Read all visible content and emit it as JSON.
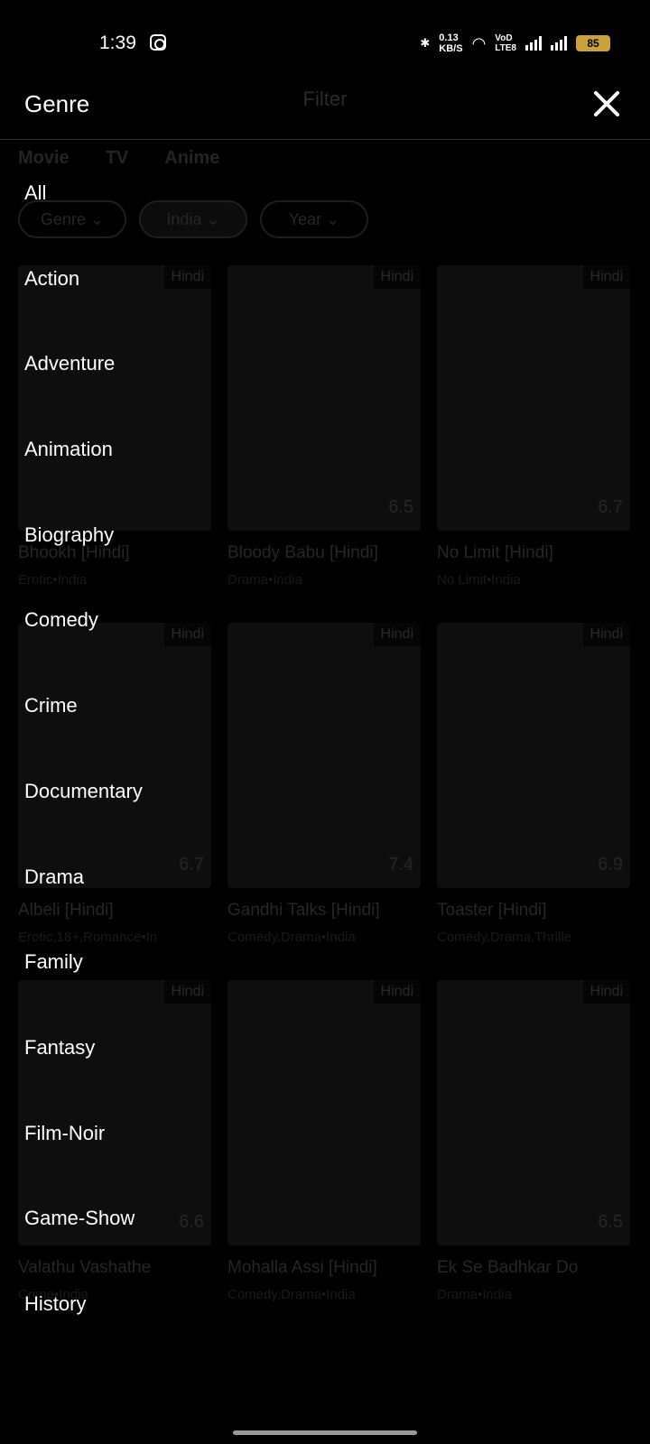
{
  "status_bar": {
    "time": "1:39",
    "net_speed_top": "0.13",
    "net_speed_bottom": "KB/S",
    "vod_top": "VoD",
    "vod_bottom": "LTE8",
    "battery": "85",
    "icons": [
      "instagram-icon",
      "bluetooth-icon",
      "wifi-icon",
      "signal-icon",
      "battery-icon"
    ]
  },
  "drawer": {
    "title": "Genre",
    "genres": [
      "All",
      "Action",
      "Adventure",
      "Animation",
      "Biography",
      "Comedy",
      "Crime",
      "Documentary",
      "Drama",
      "Family",
      "Fantasy",
      "Film-Noir",
      "Game-Show",
      "History"
    ]
  },
  "underlay": {
    "title": "Filter",
    "tabs": [
      "Movie",
      "TV",
      "Anime"
    ],
    "chips": [
      "Genre",
      "India",
      "Year"
    ],
    "cards": [
      {
        "title": "Bhookh [Hindi]",
        "sub": "Erotic•India",
        "tag": "Hindi",
        "rating": ""
      },
      {
        "title": "Bloody Babu [Hindi]",
        "sub": "Drama•India",
        "tag": "Hindi",
        "rating": "6.5"
      },
      {
        "title": "No Limit [Hindi]",
        "sub": "No Limit•India",
        "tag": "Hindi",
        "rating": "6.7"
      },
      {
        "title": "Albeli [Hindi]",
        "sub": "Erotic,18+,Romance•In",
        "tag": "Hindi",
        "rating": "6.7"
      },
      {
        "title": "Gandhi Talks [Hindi]",
        "sub": "Comedy,Drama•India",
        "tag": "Hindi",
        "rating": "7.4"
      },
      {
        "title": "Toaster [Hindi]",
        "sub": "Comedy,Drama,Thrille",
        "tag": "Hindi",
        "rating": "6.9"
      },
      {
        "title": "Valathu Vashathe",
        "sub": "Crime•India",
        "tag": "Hindi",
        "rating": "6.6"
      },
      {
        "title": "Mohalla Assi [Hindi]",
        "sub": "Comedy,Drama•India",
        "tag": "Hindi",
        "rating": ""
      },
      {
        "title": "Ek Se Badhkar Do",
        "sub": "Drama•India",
        "tag": "Hindi",
        "rating": "6.5"
      }
    ]
  }
}
